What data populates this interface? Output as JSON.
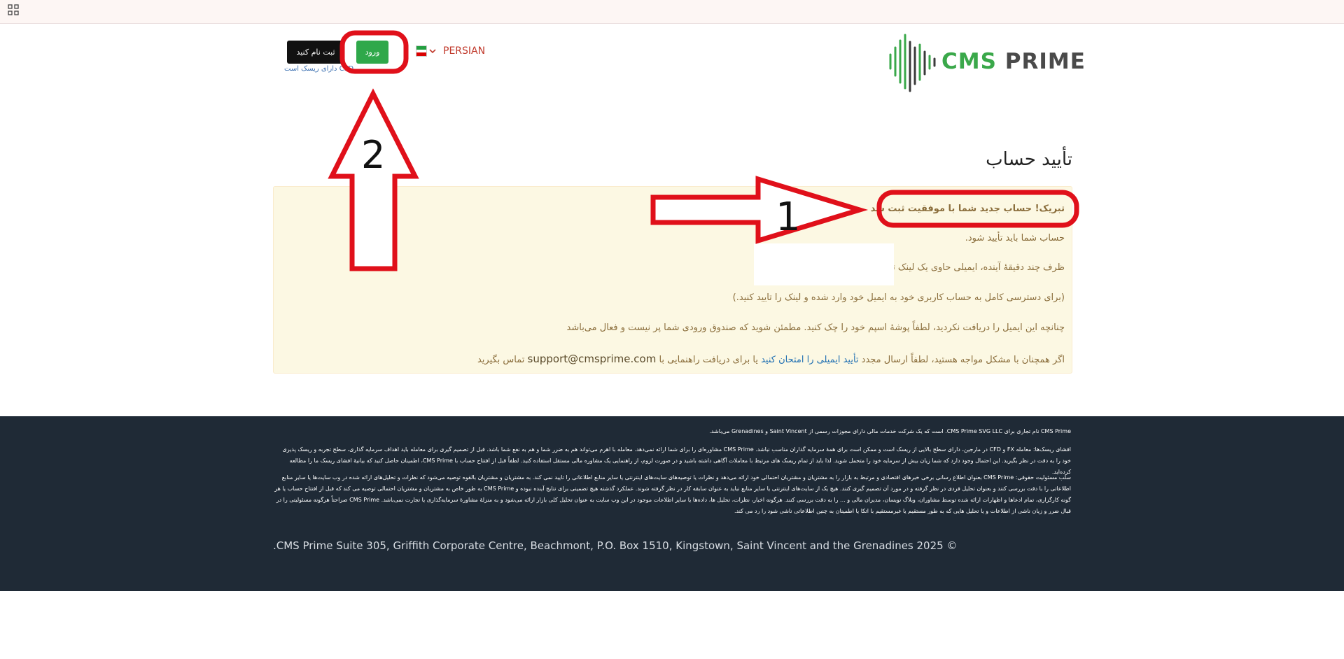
{
  "topbar": {
    "apps_icon": "grid-icon"
  },
  "header": {
    "logo": {
      "brand": "CMS",
      "name": "PRIME",
      "icon": "waveform-logo"
    },
    "register_label": "ثبت نام کنید",
    "login_label": "ورود",
    "risk_text": "CFD دارای ریسک است",
    "language": {
      "label": "PERSIAN",
      "flag": "iran-flag-icon"
    }
  },
  "main": {
    "title": "تأیید حساب",
    "alert": {
      "heading": "تبریک! حساب جدید شما با موفقیت ثبت شد",
      "line1": "حساب شما باید تأیید شود.",
      "line2": "ظرف چند دقیقهٔ آینده، ایمیلی حاوی یک لینک تأیید                               دریافت خواهید کرد",
      "line3": "(برای دسترسی کامل به حساب کاربری خود به ایمیل خود وارد شده و لینک را تایید کنید.)",
      "line4": "چنانچه این ایمیل را دریافت نکردید، لطفاً پوشهٔ اسپم خود را چک کنید. مطمئن شوید که صندوق ورودی شما پر نیست و فعال می‌باشد",
      "line5_pre": "اگر همچنان با مشکل مواجه هستید، لطفاً ارسال مجدد",
      "line5_link": "تأیید ایمیلی را امتحان کنید",
      "line5_mid": "یا برای دریافت راهنمایی با",
      "line5_email": "support@cmsprime.com",
      "line5_post": "تماس بگیرید"
    }
  },
  "footer": {
    "para1": "CMS Prime نام تجاری برای CMS Prime SVG LLC. است که یک شرکت خدمات مالی دارای مجوزات رسمی از Saint Vincent و Grenadines می‌باشد.",
    "para2": "افشای ریسک‌ها: معامله FX و CFD در مارجین، دارای سطح بالایی از ریسک است و ممکن است برای همهٔ سرمایه گذاران مناسب نباشد. CMS Prime مشاوره‌ای را برای شما ارائه نمی‌دهد. معامله با اهرم می‌تواند هم به ضرر شما و هم به نفع شما باشد. قبل از تصمیم گیری برای معامله باید اهداف سرمایه گذاری، سطح تجربه و ریسک پذیری خود را به دقت در نظر بگیرید. این احتمال وجود دارد که شما زیان بیش از سرمایه خود را متحمل شوید. لذا باید از تمام ریسک های مرتبط با معاملات آگاهی داشته باشید و در صورت لزوم، از راهنمایی یک مشاوره مالی مستقل استفاده کنید. لطفاً قبل از افتتاح حساب با CMS Prime، اطمینان حاصل کنید که بیانیهٔ افشای ریسک ما را مطالعه کرده‌اید.",
    "para3": "سلب مسئولیت حقوقی: CMS Prime بعنوان اطلاع رسانی برخی خبرهای اقتصادی و مرتبط به بازار را به مشتریان و مشتریان احتمالی خود ارائه می‌دهد و نظرات یا توصیه‌های سایت‌های اینترنتی یا سایر منابع اطلاعاتی را تایید نمی کند. به مشتریان و مشتریان بالقوه توصیه می‌شود که نظرات و تحلیل‌های ارائه شده در وب سایت‌ها یا سایر منابع اطلاعاتی را با دقت بررسی کنند و بعنوان تحلیل فردی در نظر گرفته و در مورد آن تصمیم گیری کنند. هیچ یک از سایت‌های اینترنتی یا سایر منابع نباید به عنوان سابقه کار در نظر گرفته شوند. عملکرد گذشته هیچ تضمینی برای نتایج آینده نبوده و CMS Prime به طور خاص به مشتریان و مشتریان احتمالی توصیه می کند که قبل از افتتاح حساب یا هر گونه کارگزاری، تمام ادعاها و اظهارات ارائه شده توسط مشاوران، وبلاگ نویسان، مدیران مالی و ... را به دقت بررسی کنند. هرگونه اخبار، نظرات، تحلیل ها، داده‌ها یا سایر اطلاعات موجود در این وب سایت به عنوان تحلیل کلی بازار ارائه می‌شود و به منزلهٔ مشاورهٔ سرمایه‌گذاری یا تجارت نمی‌باشد. CMS Prime صراحتاً هرگونه مسئولیتی را در قبال ضرر و زیان ناشی از اطلاعات و یا تحلیل هایی که به طور مستقیم یا غیرمستقیم با اتکا یا اطمینان به چنین اطلاعاتی ناشی شود را رد می کند.",
    "copyright": ".CMS Prime Suite 305, Griffith Corporate Centre, Beachmont, P.O. Box 1510, Kingstown, Saint Vincent and the Grenadines 2025 ©"
  },
  "annotations": [
    {
      "number": "1",
      "shape": "arrow-right",
      "color": "#e0101a"
    },
    {
      "number": "2",
      "shape": "arrow-up",
      "color": "#e0101a"
    }
  ]
}
